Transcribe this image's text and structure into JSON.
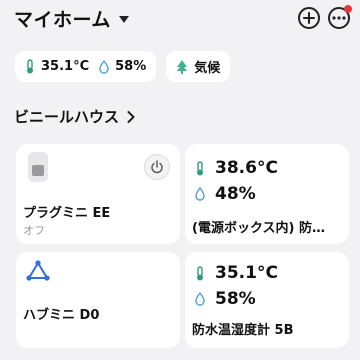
{
  "header": {
    "title": "マイホーム",
    "add_icon": "plus-icon",
    "more_icon": "more-icon",
    "notification_color": "#e53935"
  },
  "summary": {
    "temperature": "35.1°C",
    "humidity": "58%",
    "weather_label": "気候"
  },
  "section": {
    "title": "ビニールハウス"
  },
  "devices": [
    {
      "name": "プラグミニ EE",
      "status": "オフ",
      "icon": "plug-icon"
    },
    {
      "temperature": "38.6°C",
      "humidity": "48%",
      "name": "(電源ボックス内) 防…"
    },
    {
      "name": "ハブミニ D0",
      "icon": "hub-icon"
    },
    {
      "temperature": "35.1°C",
      "humidity": "58%",
      "name": "防水温湿度計 5B"
    }
  ],
  "colors": {
    "thermo": "#2e9e7a",
    "drop": "#4a9ee0",
    "hub": "#2f6fd6",
    "tree": "#3fb48e"
  }
}
